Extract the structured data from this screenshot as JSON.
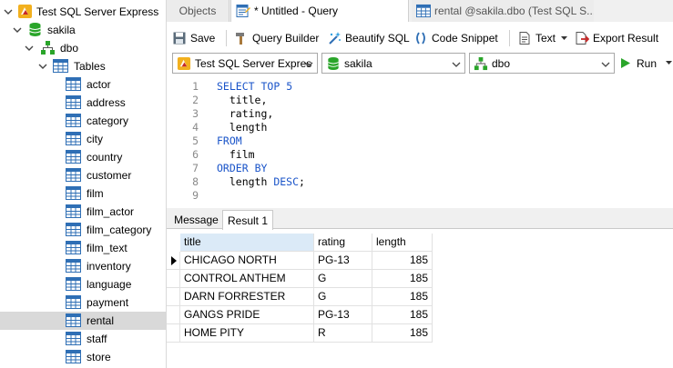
{
  "sidebar": {
    "server": "Test SQL Server Express",
    "database": "sakila",
    "schema": "dbo",
    "tables_folder": "Tables",
    "tables": [
      "actor",
      "address",
      "category",
      "city",
      "country",
      "customer",
      "film",
      "film_actor",
      "film_category",
      "film_text",
      "inventory",
      "language",
      "payment",
      "rental",
      "staff",
      "store"
    ],
    "selected_table": "rental"
  },
  "tabs": {
    "objects": "Objects",
    "query": "* Untitled - Query",
    "rental": "rental @sakila.dbo (Test SQL S..."
  },
  "toolbar": {
    "save": "Save",
    "query_builder": "Query Builder",
    "beautify": "Beautify SQL",
    "snippet": "Code Snippet",
    "text": "Text",
    "export": "Export Result"
  },
  "combos": {
    "connection": "Test SQL Server Expres",
    "database": "sakila",
    "schema": "dbo",
    "run": "Run"
  },
  "editor": {
    "lines": [
      {
        "n": "1",
        "text": "SELECT TOP 5"
      },
      {
        "n": "2",
        "text": "  title,"
      },
      {
        "n": "3",
        "text": "  rating,"
      },
      {
        "n": "4",
        "text": "  length"
      },
      {
        "n": "5",
        "text": "FROM"
      },
      {
        "n": "6",
        "text": "  film"
      },
      {
        "n": "7",
        "text": "ORDER BY"
      },
      {
        "n": "8",
        "text": "  length DESC;"
      },
      {
        "n": "9",
        "text": ""
      }
    ]
  },
  "result_tabs": {
    "message": "Message",
    "result": "Result 1"
  },
  "grid": {
    "columns": [
      "title",
      "rating",
      "length"
    ],
    "rows": [
      [
        "CHICAGO NORTH",
        "PG-13",
        "185"
      ],
      [
        "CONTROL ANTHEM",
        "G",
        "185"
      ],
      [
        "DARN FORRESTER",
        "G",
        "185"
      ],
      [
        "GANGS PRIDE",
        "PG-13",
        "185"
      ],
      [
        "HOME PITY",
        "R",
        "185"
      ]
    ]
  },
  "colors": {
    "keyword": "#1a54c9",
    "db_green": "#2aa52a",
    "table_blue": "#2f6fb5",
    "selected_row": "#d9d9d9",
    "header_active": "#dbeaf7"
  }
}
